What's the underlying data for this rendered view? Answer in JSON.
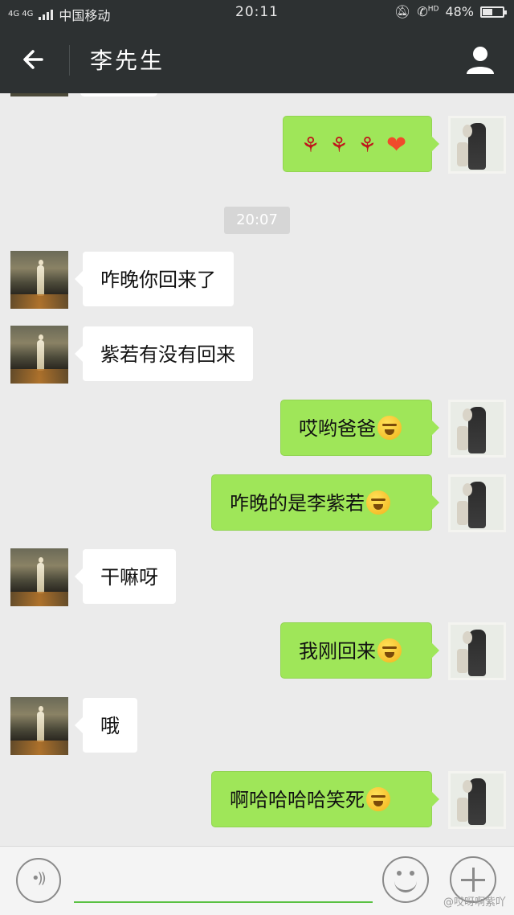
{
  "status_bar": {
    "network": "4G 4G",
    "carrier": "中国移动",
    "time": "20:11",
    "hd": "HD",
    "battery_percent": "48%",
    "battery_level": 0.48
  },
  "header": {
    "back_icon": "arrow-left-icon",
    "title": "李先生",
    "profile_icon": "person-icon"
  },
  "timestamp": "20:07",
  "messages": [
    {
      "side": "right",
      "text": "",
      "emoji": "rose rose rose heart"
    },
    {
      "side": "left",
      "text": "咋晚你回来了"
    },
    {
      "side": "left",
      "text": "紫若有没有回来"
    },
    {
      "side": "right",
      "text": "哎哟爸爸",
      "emoji": "crying-laughing"
    },
    {
      "side": "right",
      "text": "咋晚的是李紫若",
      "emoji": "crying-laughing"
    },
    {
      "side": "left",
      "text": "干嘛呀"
    },
    {
      "side": "right",
      "text": "我刚回来",
      "emoji": "crying-laughing"
    },
    {
      "side": "left",
      "text": "哦"
    },
    {
      "side": "right",
      "text": "啊哈哈哈哈笑死",
      "emoji": "grinning"
    }
  ],
  "input_bar": {
    "voice_icon": "voice-icon",
    "emoji_icon": "smiley-icon",
    "plus_icon": "plus-icon"
  },
  "watermark": "@哎呀啊紫吖",
  "colors": {
    "bar_bg": "#2d3132",
    "chat_bg": "#ebebeb",
    "bubble_green": "#9fe659",
    "accent_line": "#59c142"
  }
}
